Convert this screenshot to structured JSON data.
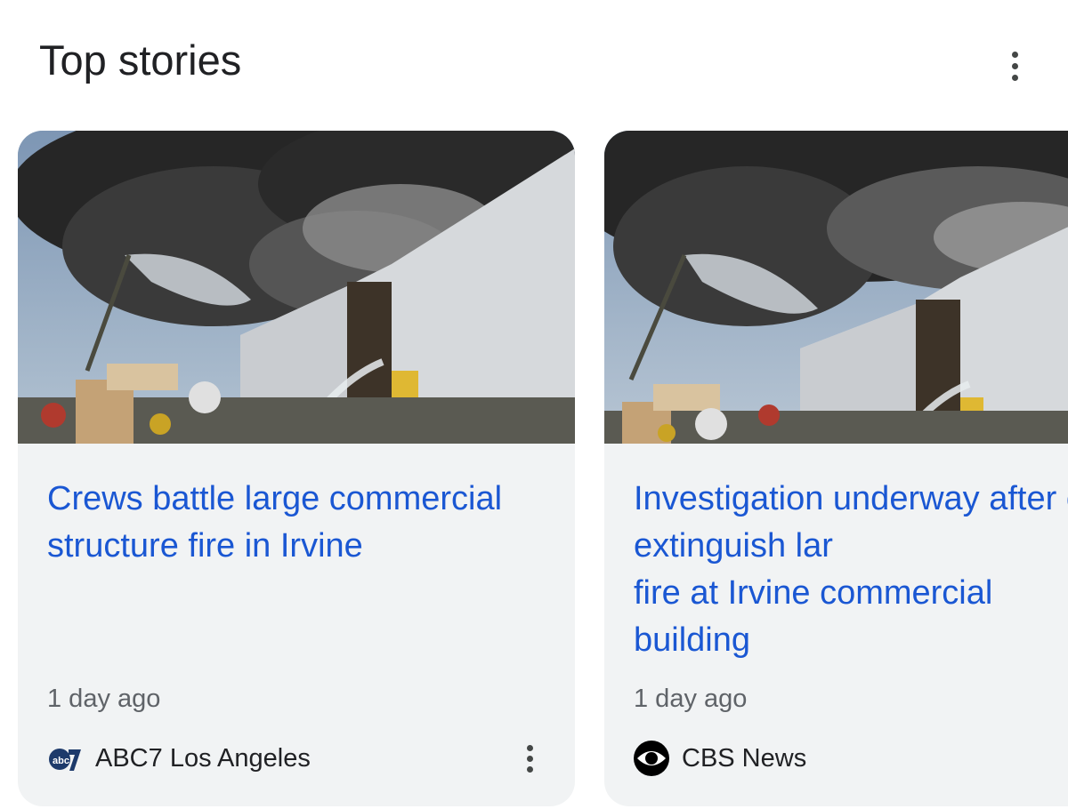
{
  "section": {
    "title": "Top stories"
  },
  "stories": [
    {
      "headline": "Crews battle large commercial structure fire in Irvine",
      "time": "1 day ago",
      "source": "ABC7 Los Angeles",
      "logo_icon": "abc7-logo"
    },
    {
      "headline": "Investigation underway after crews extinguish lar\nfire at Irvine commercial\nbuilding",
      "time": "1 day ago",
      "source": "CBS News",
      "logo_icon": "cbs-eye-logo"
    }
  ],
  "colors": {
    "headline": "#1a57d3",
    "card_bg": "#f1f3f4",
    "meta_text": "#5f6368",
    "title_text": "#202124"
  }
}
